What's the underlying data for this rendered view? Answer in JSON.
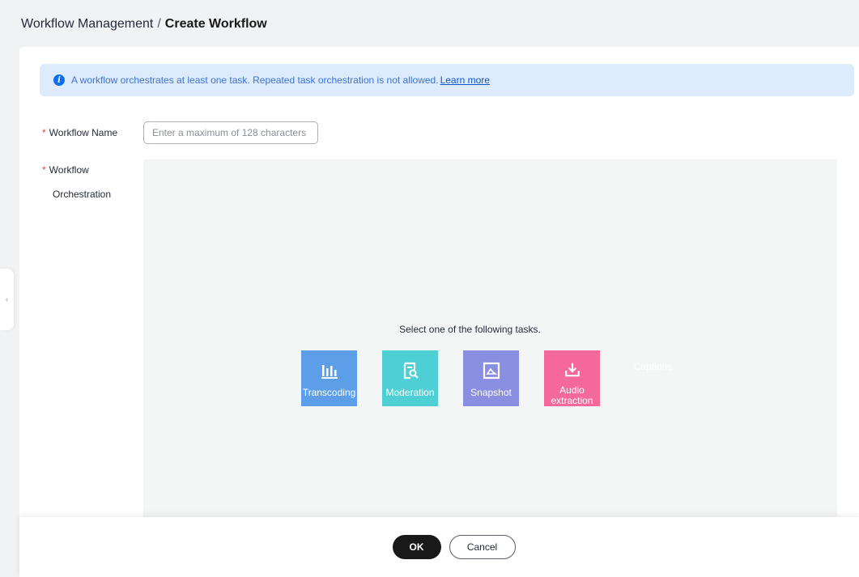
{
  "breadcrumb": {
    "parent": "Workflow Management",
    "separator": "/",
    "current": "Create Workflow"
  },
  "alert": {
    "message": "A workflow orchestrates at least one task. Repeated task orchestration is not allowed.",
    "link": "Learn more",
    "icon": "info-icon"
  },
  "form": {
    "required_mark": "*",
    "name_label": "Workflow Name",
    "name_placeholder": "Enter a maximum of 128 characters",
    "name_value": "",
    "orchestration_label_line1": "Workflow",
    "orchestration_label_line2": "Orchestration"
  },
  "canvas": {
    "hint": "Select one of the following tasks.",
    "tasks": [
      {
        "label": "Transcoding",
        "icon": "bar-chart-icon",
        "color": "#5d9ee9"
      },
      {
        "label": "Moderation",
        "icon": "document-search-icon",
        "color": "#4ecfd3"
      },
      {
        "label": "Snapshot",
        "icon": "image-icon",
        "color": "#8a8ee0"
      },
      {
        "label": "Audio extraction",
        "icon": "download-icon",
        "color": "#f5689a"
      },
      {
        "label": "Captions",
        "icon": "",
        "color": "#ffffff"
      }
    ]
  },
  "footer": {
    "ok": "OK",
    "cancel": "Cancel"
  },
  "colors": {
    "alert_bg": "#deebfc",
    "primary_button": "#191919",
    "required": "#e54545"
  }
}
